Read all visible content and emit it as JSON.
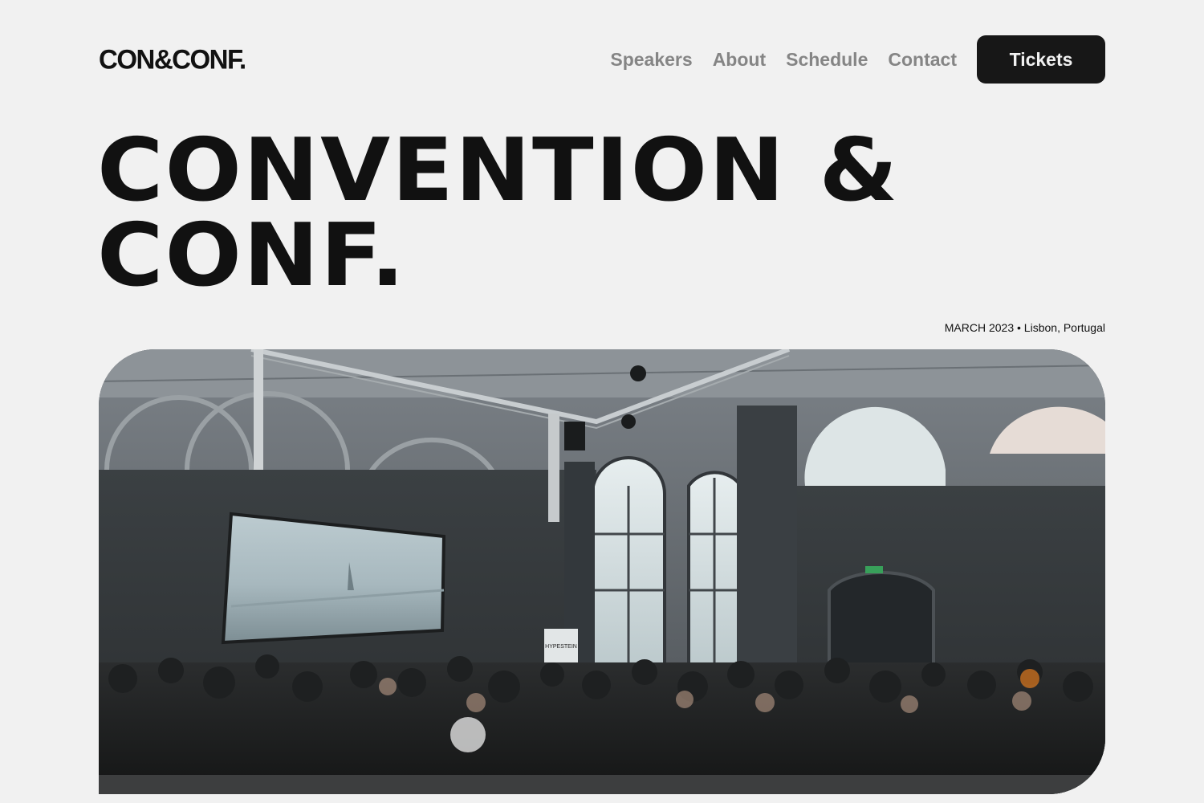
{
  "header": {
    "logo": "CON&CONF.",
    "nav": [
      {
        "label": "Speakers"
      },
      {
        "label": "About"
      },
      {
        "label": "Schedule"
      },
      {
        "label": "Contact"
      }
    ],
    "cta_label": "Tickets"
  },
  "hero": {
    "title_line1": "CONVENTION &",
    "title_line2": "CONF.",
    "meta": "MARCH 2023 • Lisbon, Portugal",
    "image_sign": "HYPESTEIN"
  },
  "colors": {
    "background": "#f1f1f1",
    "text": "#111111",
    "nav_text": "#858585",
    "button_bg": "#171717"
  }
}
